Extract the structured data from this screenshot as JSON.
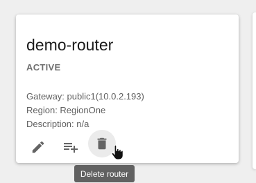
{
  "router": {
    "name": "demo-router",
    "status": "ACTIVE",
    "gateway": "Gateway: public1(10.0.2.193)",
    "region": "Region: RegionOne",
    "description": "Description: n/a"
  },
  "actions": [
    {
      "name": "edit",
      "icon": "pencil-icon"
    },
    {
      "name": "manage-rules",
      "icon": "playlist-add-icon"
    },
    {
      "name": "delete",
      "icon": "trash-icon",
      "tooltip": "Delete router"
    }
  ],
  "colors": {
    "icon": "#646464",
    "tooltip_bg": "#616161",
    "status": "#707070"
  }
}
